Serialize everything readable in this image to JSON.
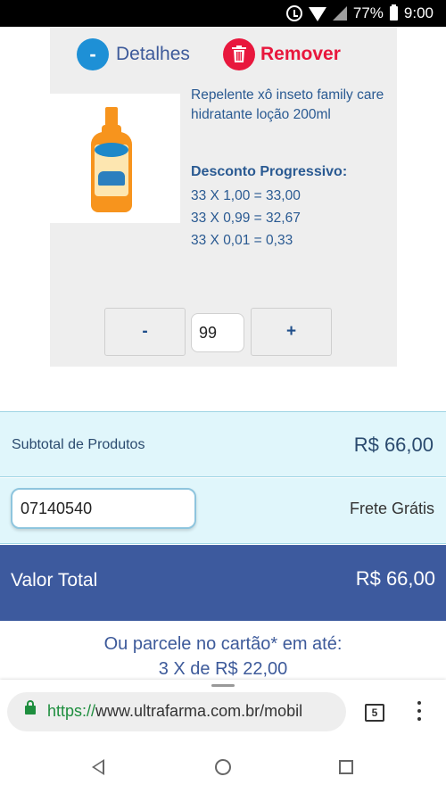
{
  "status_bar": {
    "battery": "77%",
    "time": "9:00"
  },
  "cart_item": {
    "details_label": "Detalhes",
    "details_icon_text": "-",
    "remove_label": "Remover",
    "product_name": "Repelente xô inseto family care hidratante loção 200ml",
    "discount_title": "Desconto Progressivo:",
    "discount_lines": [
      "33 X 1,00 = 33,00",
      "33 X 0,99 = 32,67",
      "33 X 0,01 = 0,33"
    ],
    "qty_minus": "-",
    "qty_value": "99",
    "qty_plus": "+"
  },
  "summary": {
    "subtotal_label": "Subtotal de Produtos",
    "subtotal_value": "R$ 66,00",
    "cep_value": "07140540",
    "shipping_label": "Frete Grátis",
    "total_label": "Valor Total",
    "total_value": "R$ 66,00",
    "installment_line1": "Ou parcele no cartão* em até:",
    "installment_line2": "3 X de R$ 22,00"
  },
  "browser": {
    "url_scheme": "https://",
    "url_host": "www.ultrafarma.com.br/mobil",
    "tab_count": "5"
  },
  "colors": {
    "accent_blue": "#3d5a9e",
    "remove_red": "#e8173d",
    "light_cyan": "#e0f6fb",
    "secure_green": "#1e8e3e"
  }
}
